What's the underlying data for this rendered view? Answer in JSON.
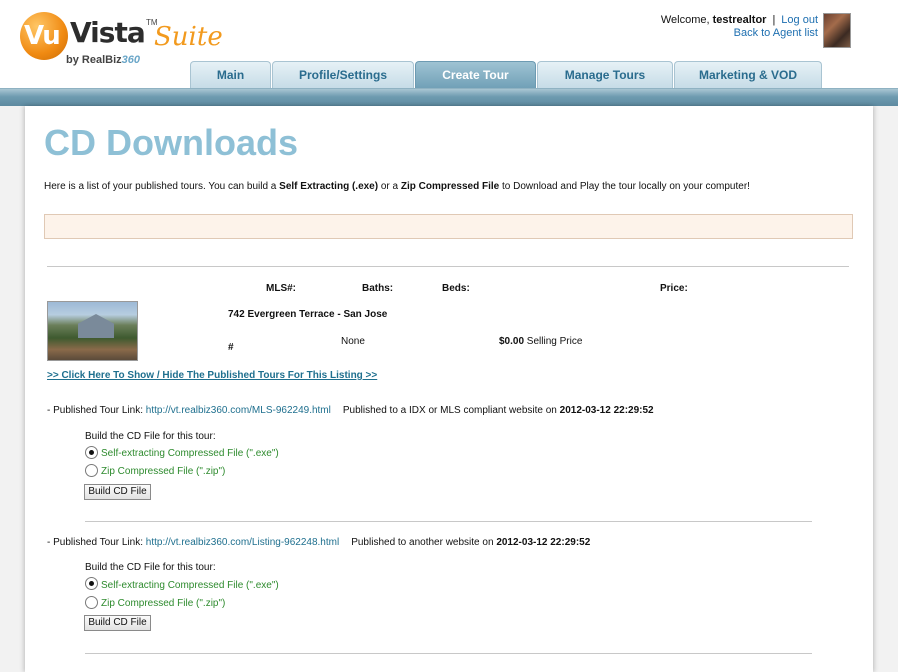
{
  "header": {
    "logo": {
      "badge": "Vu",
      "name": "Vista",
      "tm": "TM",
      "suite": "Suite",
      "by": "by RealBiz",
      "by_360": "360"
    },
    "welcome_prefix": "Welcome, ",
    "username": "testrealtor",
    "separator": "|",
    "logout": "Log out",
    "back_to_agent": "Back to Agent list"
  },
  "tabs": [
    {
      "label": "Main",
      "active": false
    },
    {
      "label": "Profile/Settings",
      "active": false
    },
    {
      "label": "Create Tour",
      "active": true
    },
    {
      "label": "Manage Tours",
      "active": false
    },
    {
      "label": "Marketing & VOD",
      "active": false
    }
  ],
  "page": {
    "title": "CD Downloads",
    "intro": {
      "part1": "Here is a list of your published tours. You can build a ",
      "bold1": "Self Extracting (.exe)",
      "part2": " or a ",
      "bold2": "Zip Compressed File",
      "part3": " to Download and Play the tour locally on your computer!"
    }
  },
  "listing": {
    "headers": {
      "mls": "MLS#:",
      "baths": "Baths:",
      "beds": "Beds:",
      "price": "Price:"
    },
    "address": "742 Evergreen Terrace - San Jose",
    "mls_value": "#",
    "baths_value": "None",
    "price_value": "$0.00",
    "price_suffix": " Selling Price",
    "toggle_link": ">> Click Here To Show / Hide The Published Tours For This Listing >>"
  },
  "tours": [
    {
      "prefix": "- Published Tour Link: ",
      "url": "http://vt.realbiz360.com/MLS-962249.html",
      "published_text": "Published to a IDX or MLS compliant website on ",
      "date": "2012-03-12 22:29:52",
      "build_label": "Build the CD File for this tour:",
      "opt_exe": "Self-extracting Compressed File (\".exe\")",
      "opt_zip": "Zip Compressed File (\".zip\")",
      "button": "Build CD File"
    },
    {
      "prefix": "- Published Tour Link: ",
      "url": "http://vt.realbiz360.com/Listing-962248.html",
      "published_text": "Published to another website on ",
      "date": "2012-03-12 22:29:52",
      "build_label": "Build the CD File for this tour:",
      "opt_exe": "Self-extracting Compressed File (\".exe\")",
      "opt_zip": "Zip Compressed File (\".zip\")",
      "button": "Build CD File"
    }
  ]
}
